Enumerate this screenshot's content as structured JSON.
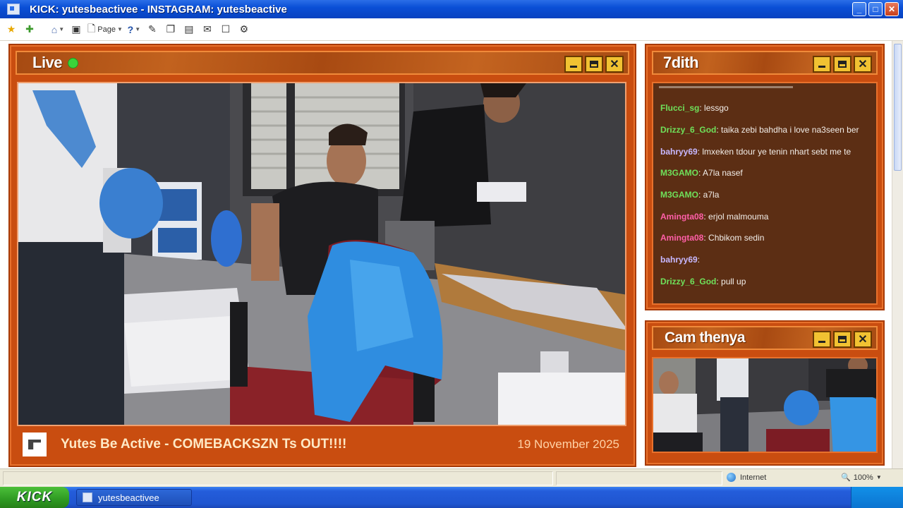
{
  "window": {
    "title": "KICK: yutesbeactivee - INSTAGRAM: yutesbeactive",
    "controls": {
      "minimize": "_",
      "maximize": "□",
      "close": "✕"
    }
  },
  "toolbar": {
    "page_label": "Page"
  },
  "live_panel": {
    "title": "Live",
    "stream_title": "Yutes Be Active - COMEBACKSZN Ts OUT!!!!",
    "date": "19 November 2025"
  },
  "chat_panel": {
    "title": "7dith",
    "messages": [
      {
        "user": "Flucci_sg",
        "sep": ":",
        "text": " lessgo",
        "color": "green"
      },
      {
        "user": "Drizzy_6_God",
        "sep": ":",
        "text": " taika zebi bahdha i love na3seen ber",
        "color": "green"
      },
      {
        "user": "bahryy69",
        "sep": ":",
        "text": " lmxeken tdour ye tenin nhart sebt me te",
        "color": "lav"
      },
      {
        "user": "M3GAMO",
        "sep": ":",
        "text": " A7la nasef",
        "color": "green"
      },
      {
        "user": "M3GAMO",
        "sep": ":",
        "text": " a7la",
        "color": "green"
      },
      {
        "user": "Amingta08",
        "sep": ":",
        "text": " erjol malmouma",
        "color": "pink"
      },
      {
        "user": "Amingta08",
        "sep": ":",
        "text": " Chbikom sedin",
        "color": "pink"
      },
      {
        "user": "bahryy69",
        "sep": ":",
        "text": "",
        "color": "lav"
      },
      {
        "user": "Drizzy_6_God",
        "sep": ":",
        "text": " pull up",
        "color": "green"
      }
    ]
  },
  "cam_panel": {
    "title": "Cam thenya"
  },
  "statusbar": {
    "zone": "Internet",
    "zoom": "100%"
  },
  "taskbar": {
    "start_label": "KICK",
    "item_label": "yutesbeactivee"
  }
}
